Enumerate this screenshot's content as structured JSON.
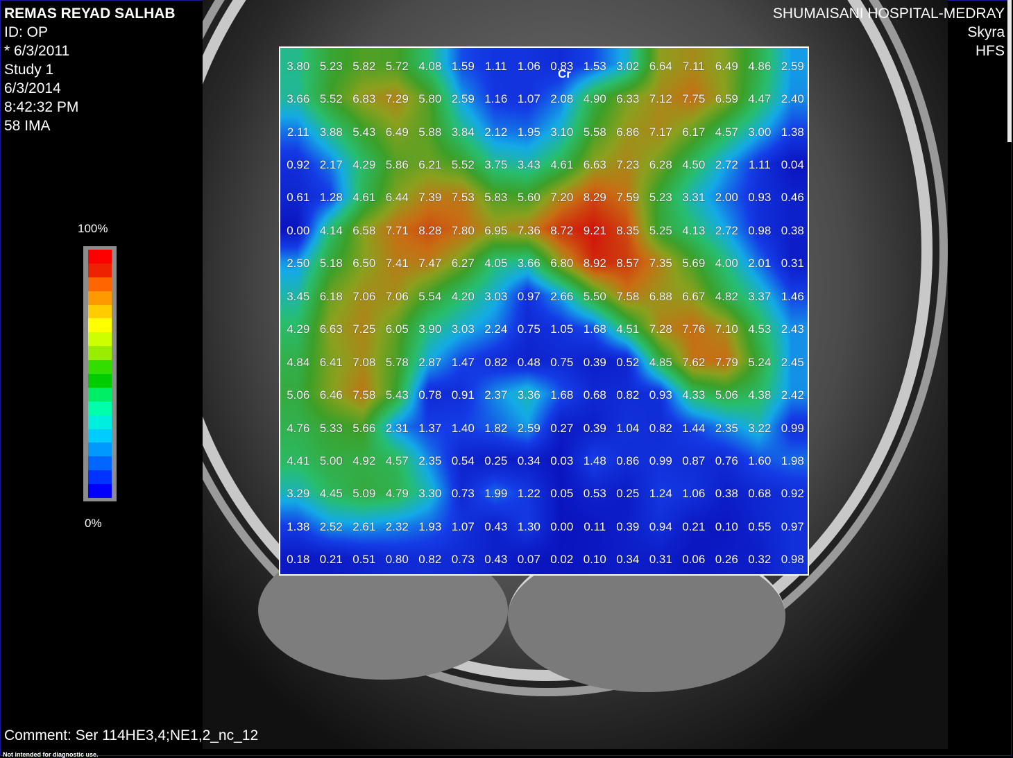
{
  "patient": {
    "name": "REMAS REYAD SALHAB",
    "id": "ID: OP",
    "birth": "* 6/3/2011",
    "study": "Study 1",
    "date": "6/3/2014",
    "time": "8:42:32 PM",
    "image": "58 IMA"
  },
  "institution": {
    "name": "SHUMAISANI HOSPITAL-MEDRAY",
    "scanner": "Skyra",
    "position": "HFS"
  },
  "legend": {
    "max_label": "100%",
    "min_label": "0%",
    "colors": [
      "#ff0000",
      "#ee2200",
      "#ff6600",
      "#ff9900",
      "#ffcc00",
      "#ffff00",
      "#ccff00",
      "#99ee00",
      "#33dd00",
      "#00cc00",
      "#00ee66",
      "#00ffaa",
      "#00eedd",
      "#00ccff",
      "#0099ff",
      "#0066ff",
      "#0033ff",
      "#0000ff"
    ]
  },
  "map": {
    "metabolite": "Cr",
    "max_value": 9.21,
    "rows": [
      [
        "3.80",
        "5.23",
        "5.82",
        "5.72",
        "4.08",
        "1.59",
        "1.11",
        "1.06",
        "0.83",
        "1.53",
        "3.02",
        "6.64",
        "7.11",
        "6.49",
        "4.86",
        "2.59"
      ],
      [
        "3.66",
        "5.52",
        "6.83",
        "7.29",
        "5.80",
        "2.59",
        "1.16",
        "1.07",
        "2.08",
        "4.90",
        "6.33",
        "7.12",
        "7.75",
        "6.59",
        "4.47",
        "2.40"
      ],
      [
        "2.11",
        "3.88",
        "5.43",
        "6.49",
        "5.88",
        "3.84",
        "2.12",
        "1.95",
        "3.10",
        "5.58",
        "6.86",
        "7.17",
        "6.17",
        "4.57",
        "3.00",
        "1.38"
      ],
      [
        "0.92",
        "2.17",
        "4.29",
        "5.86",
        "6.21",
        "5.52",
        "3.75",
        "3.43",
        "4.61",
        "6.63",
        "7.23",
        "6.28",
        "4.50",
        "2.72",
        "1.11",
        "0.04"
      ],
      [
        "0.61",
        "1.28",
        "4.61",
        "6.44",
        "7.39",
        "7.53",
        "5.83",
        "5.60",
        "7.20",
        "8.29",
        "7.59",
        "5.23",
        "3.31",
        "2.00",
        "0.93",
        "0.46"
      ],
      [
        "0.00",
        "4.14",
        "6.58",
        "7.71",
        "8.28",
        "7.80",
        "6.95",
        "7.36",
        "8.72",
        "9.21",
        "8.35",
        "5.25",
        "4.13",
        "2.72",
        "0.98",
        "0.38"
      ],
      [
        "2.50",
        "5.18",
        "6.50",
        "7.41",
        "7.47",
        "6.27",
        "4.05",
        "3.66",
        "6.80",
        "8.92",
        "8.57",
        "7.35",
        "5.69",
        "4.00",
        "2.01",
        "0.31"
      ],
      [
        "3.45",
        "6.18",
        "7.06",
        "7.06",
        "5.54",
        "4.20",
        "3.03",
        "0.97",
        "2.66",
        "5.50",
        "7.58",
        "6.88",
        "6.67",
        "4.82",
        "3.37",
        "1.46"
      ],
      [
        "4.29",
        "6.63",
        "7.25",
        "6.05",
        "3.90",
        "3.03",
        "2.24",
        "0.75",
        "1.05",
        "1.68",
        "4.51",
        "7.28",
        "7.76",
        "7.10",
        "4.53",
        "2.43"
      ],
      [
        "4.84",
        "6.41",
        "7.08",
        "5.78",
        "2.87",
        "1.47",
        "0.82",
        "0.48",
        "0.75",
        "0.39",
        "0.52",
        "4.85",
        "7.62",
        "7.79",
        "5.24",
        "2.45"
      ],
      [
        "5.06",
        "6.46",
        "7.58",
        "5.43",
        "0.78",
        "0.91",
        "2.37",
        "3.36",
        "1.68",
        "0.68",
        "0.82",
        "0.93",
        "4.33",
        "5.06",
        "4.38",
        "2.42"
      ],
      [
        "4.76",
        "5.33",
        "5.66",
        "2.31",
        "1.37",
        "1.40",
        "1.82",
        "2.59",
        "0.27",
        "0.39",
        "1.04",
        "0.82",
        "1.44",
        "2.35",
        "3.22",
        "0.99"
      ],
      [
        "4.41",
        "5.00",
        "4.92",
        "4.57",
        "2.35",
        "0.54",
        "0.25",
        "0.34",
        "0.03",
        "1.48",
        "0.86",
        "0.99",
        "0.87",
        "0.76",
        "1.60",
        "1.98"
      ],
      [
        "3.29",
        "4.45",
        "5.09",
        "4.79",
        "3.30",
        "0.73",
        "1.99",
        "1.22",
        "0.05",
        "0.53",
        "0.25",
        "1.24",
        "1.06",
        "0.38",
        "0.68",
        "0.92"
      ],
      [
        "1.38",
        "2.52",
        "2.61",
        "2.32",
        "1.93",
        "1.07",
        "0.43",
        "1.30",
        "0.00",
        "0.11",
        "0.39",
        "0.94",
        "0.21",
        "0.10",
        "0.55",
        "0.97"
      ],
      [
        "0.18",
        "0.21",
        "0.51",
        "0.80",
        "0.82",
        "0.73",
        "0.43",
        "0.07",
        "0.02",
        "0.10",
        "0.34",
        "0.31",
        "0.06",
        "0.26",
        "0.32",
        "0.98"
      ]
    ]
  },
  "comment": "Comment: Ser 114HE3,4;NE1,2_nc_12",
  "disclaimer": "Not intended for diagnostic use."
}
